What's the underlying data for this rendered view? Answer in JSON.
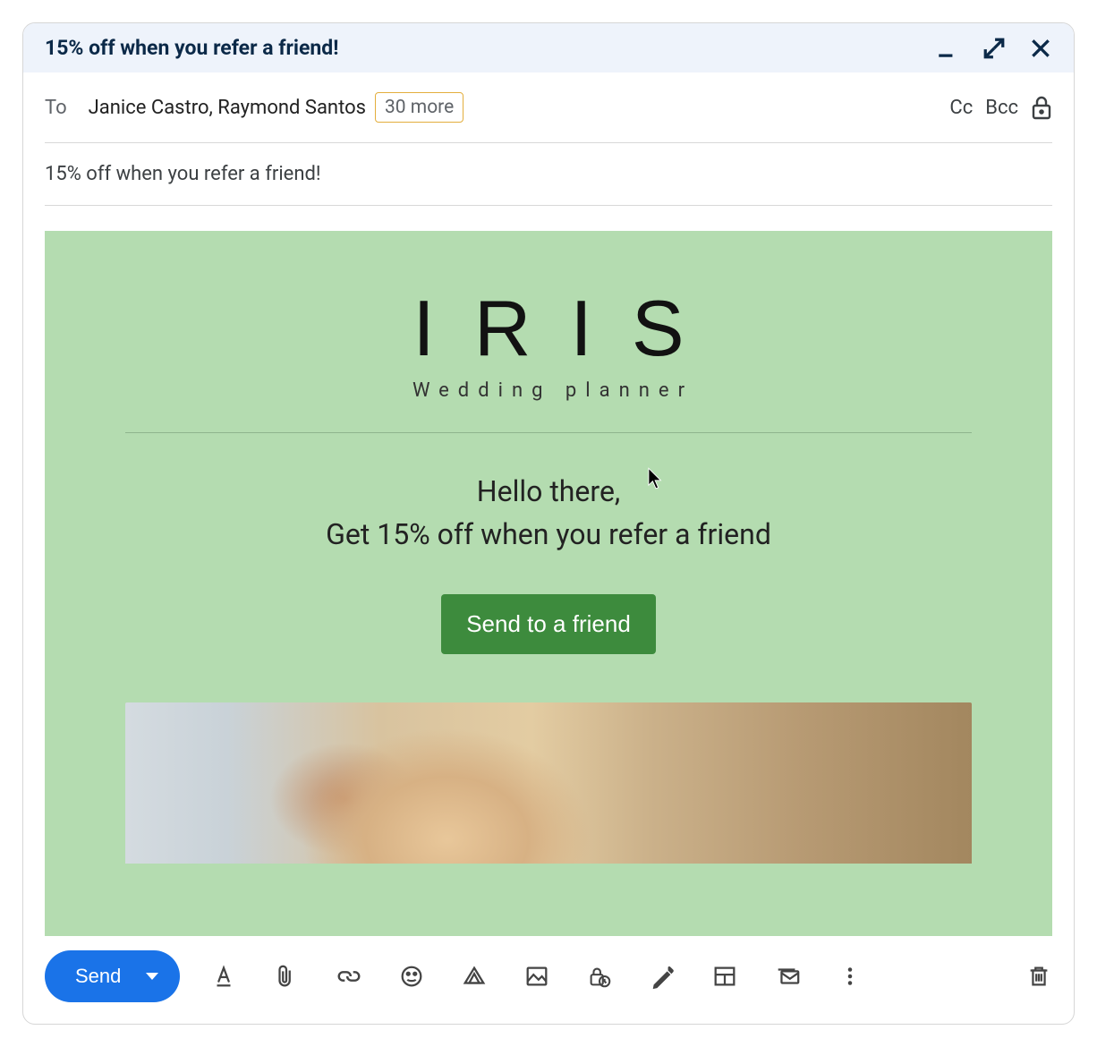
{
  "titlebar": {
    "title": "15% off when you refer a friend!"
  },
  "to": {
    "label": "To",
    "recipients": "Janice Castro, Raymond Santos",
    "more_badge": "30 more",
    "cc": "Cc",
    "bcc": "Bcc"
  },
  "subject": "15% off when you refer a friend!",
  "email": {
    "brand_name": "IRIS",
    "brand_tagline": "Wedding planner",
    "greeting": "Hello there,",
    "offer": "Get 15% off when you refer a friend",
    "cta_label": "Send to a friend"
  },
  "toolbar": {
    "send_label": "Send"
  },
  "colors": {
    "accent": "#1a73e8",
    "canvas": "#b4dcb0",
    "cta": "#3d8b3d"
  }
}
